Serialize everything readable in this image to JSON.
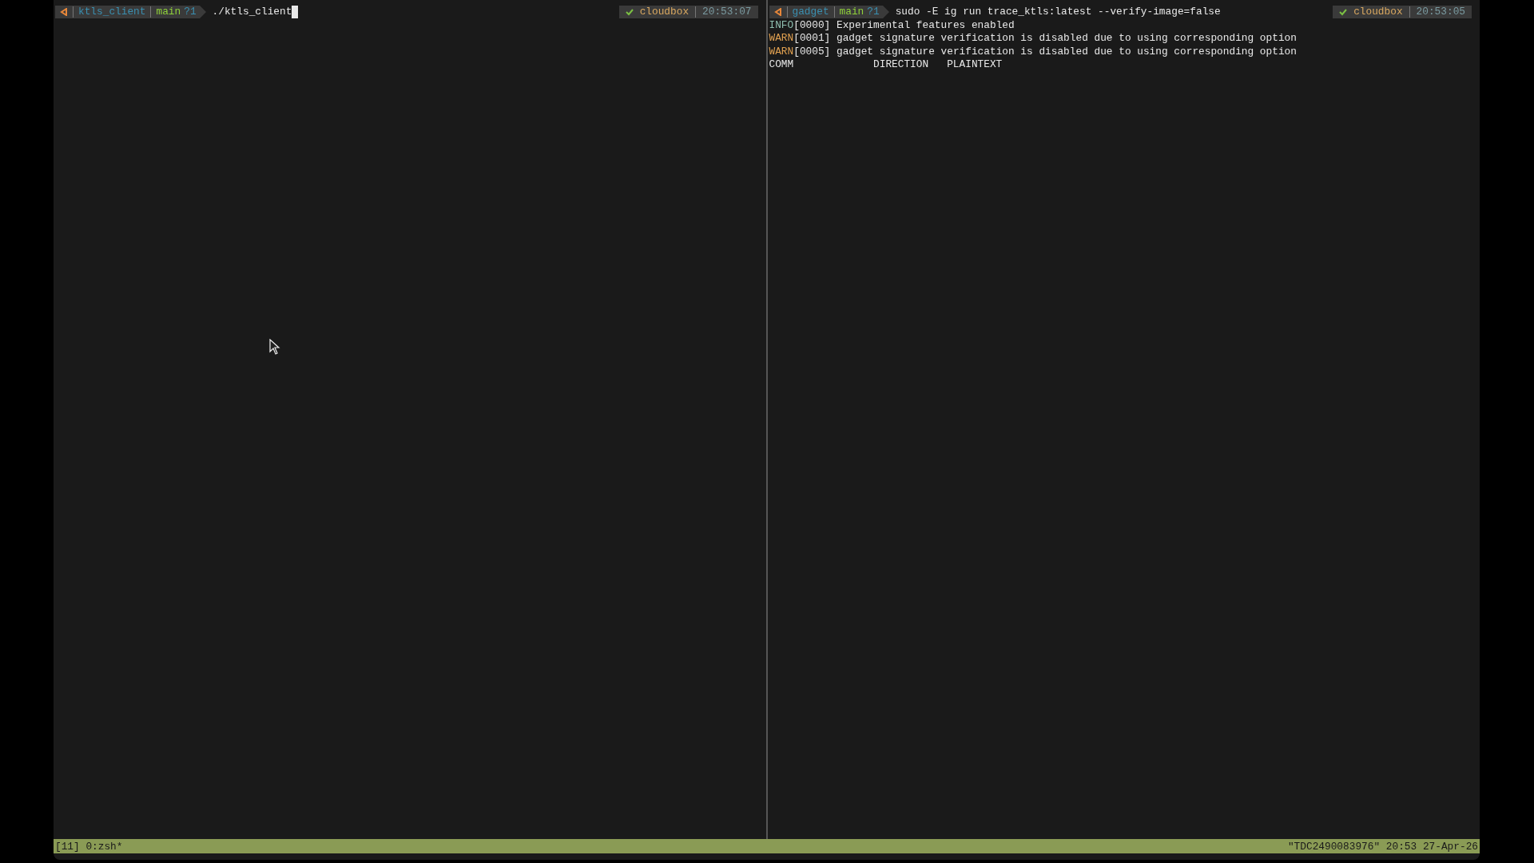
{
  "panes": [
    {
      "prompt": {
        "directory": "ktls_client",
        "branch": "main",
        "git_status": "?1",
        "command": "./ktls_client"
      },
      "cursor": true,
      "right_prompt": {
        "host": "cloudbox",
        "time": "20:53:07"
      }
    },
    {
      "prompt": {
        "directory": "gadget",
        "branch": "main",
        "git_status": "?1",
        "command": "sudo -E ig run trace_ktls:latest --verify-image=false"
      },
      "right_prompt": {
        "host": "cloudbox",
        "time": "20:53:05"
      },
      "output": [
        {
          "kind": "info",
          "level_tag": "INFO",
          "text": "[0000] Experimental features enabled"
        },
        {
          "kind": "warn",
          "level_tag": "WARN",
          "text": "[0001] gadget signature verification is disabled due to using corresponding option"
        },
        {
          "kind": "warn",
          "level_tag": "WARN",
          "text": "[0005] gadget signature verification is disabled due to using corresponding option"
        },
        {
          "kind": "header",
          "columns": [
            "COMM",
            "DIRECTION",
            "PLAINTEXT"
          ]
        }
      ]
    }
  ],
  "status_bar": {
    "left": "[11] 0:zsh*",
    "right": "\"TDC2490083976\" 20:53 27-Apr-26"
  }
}
